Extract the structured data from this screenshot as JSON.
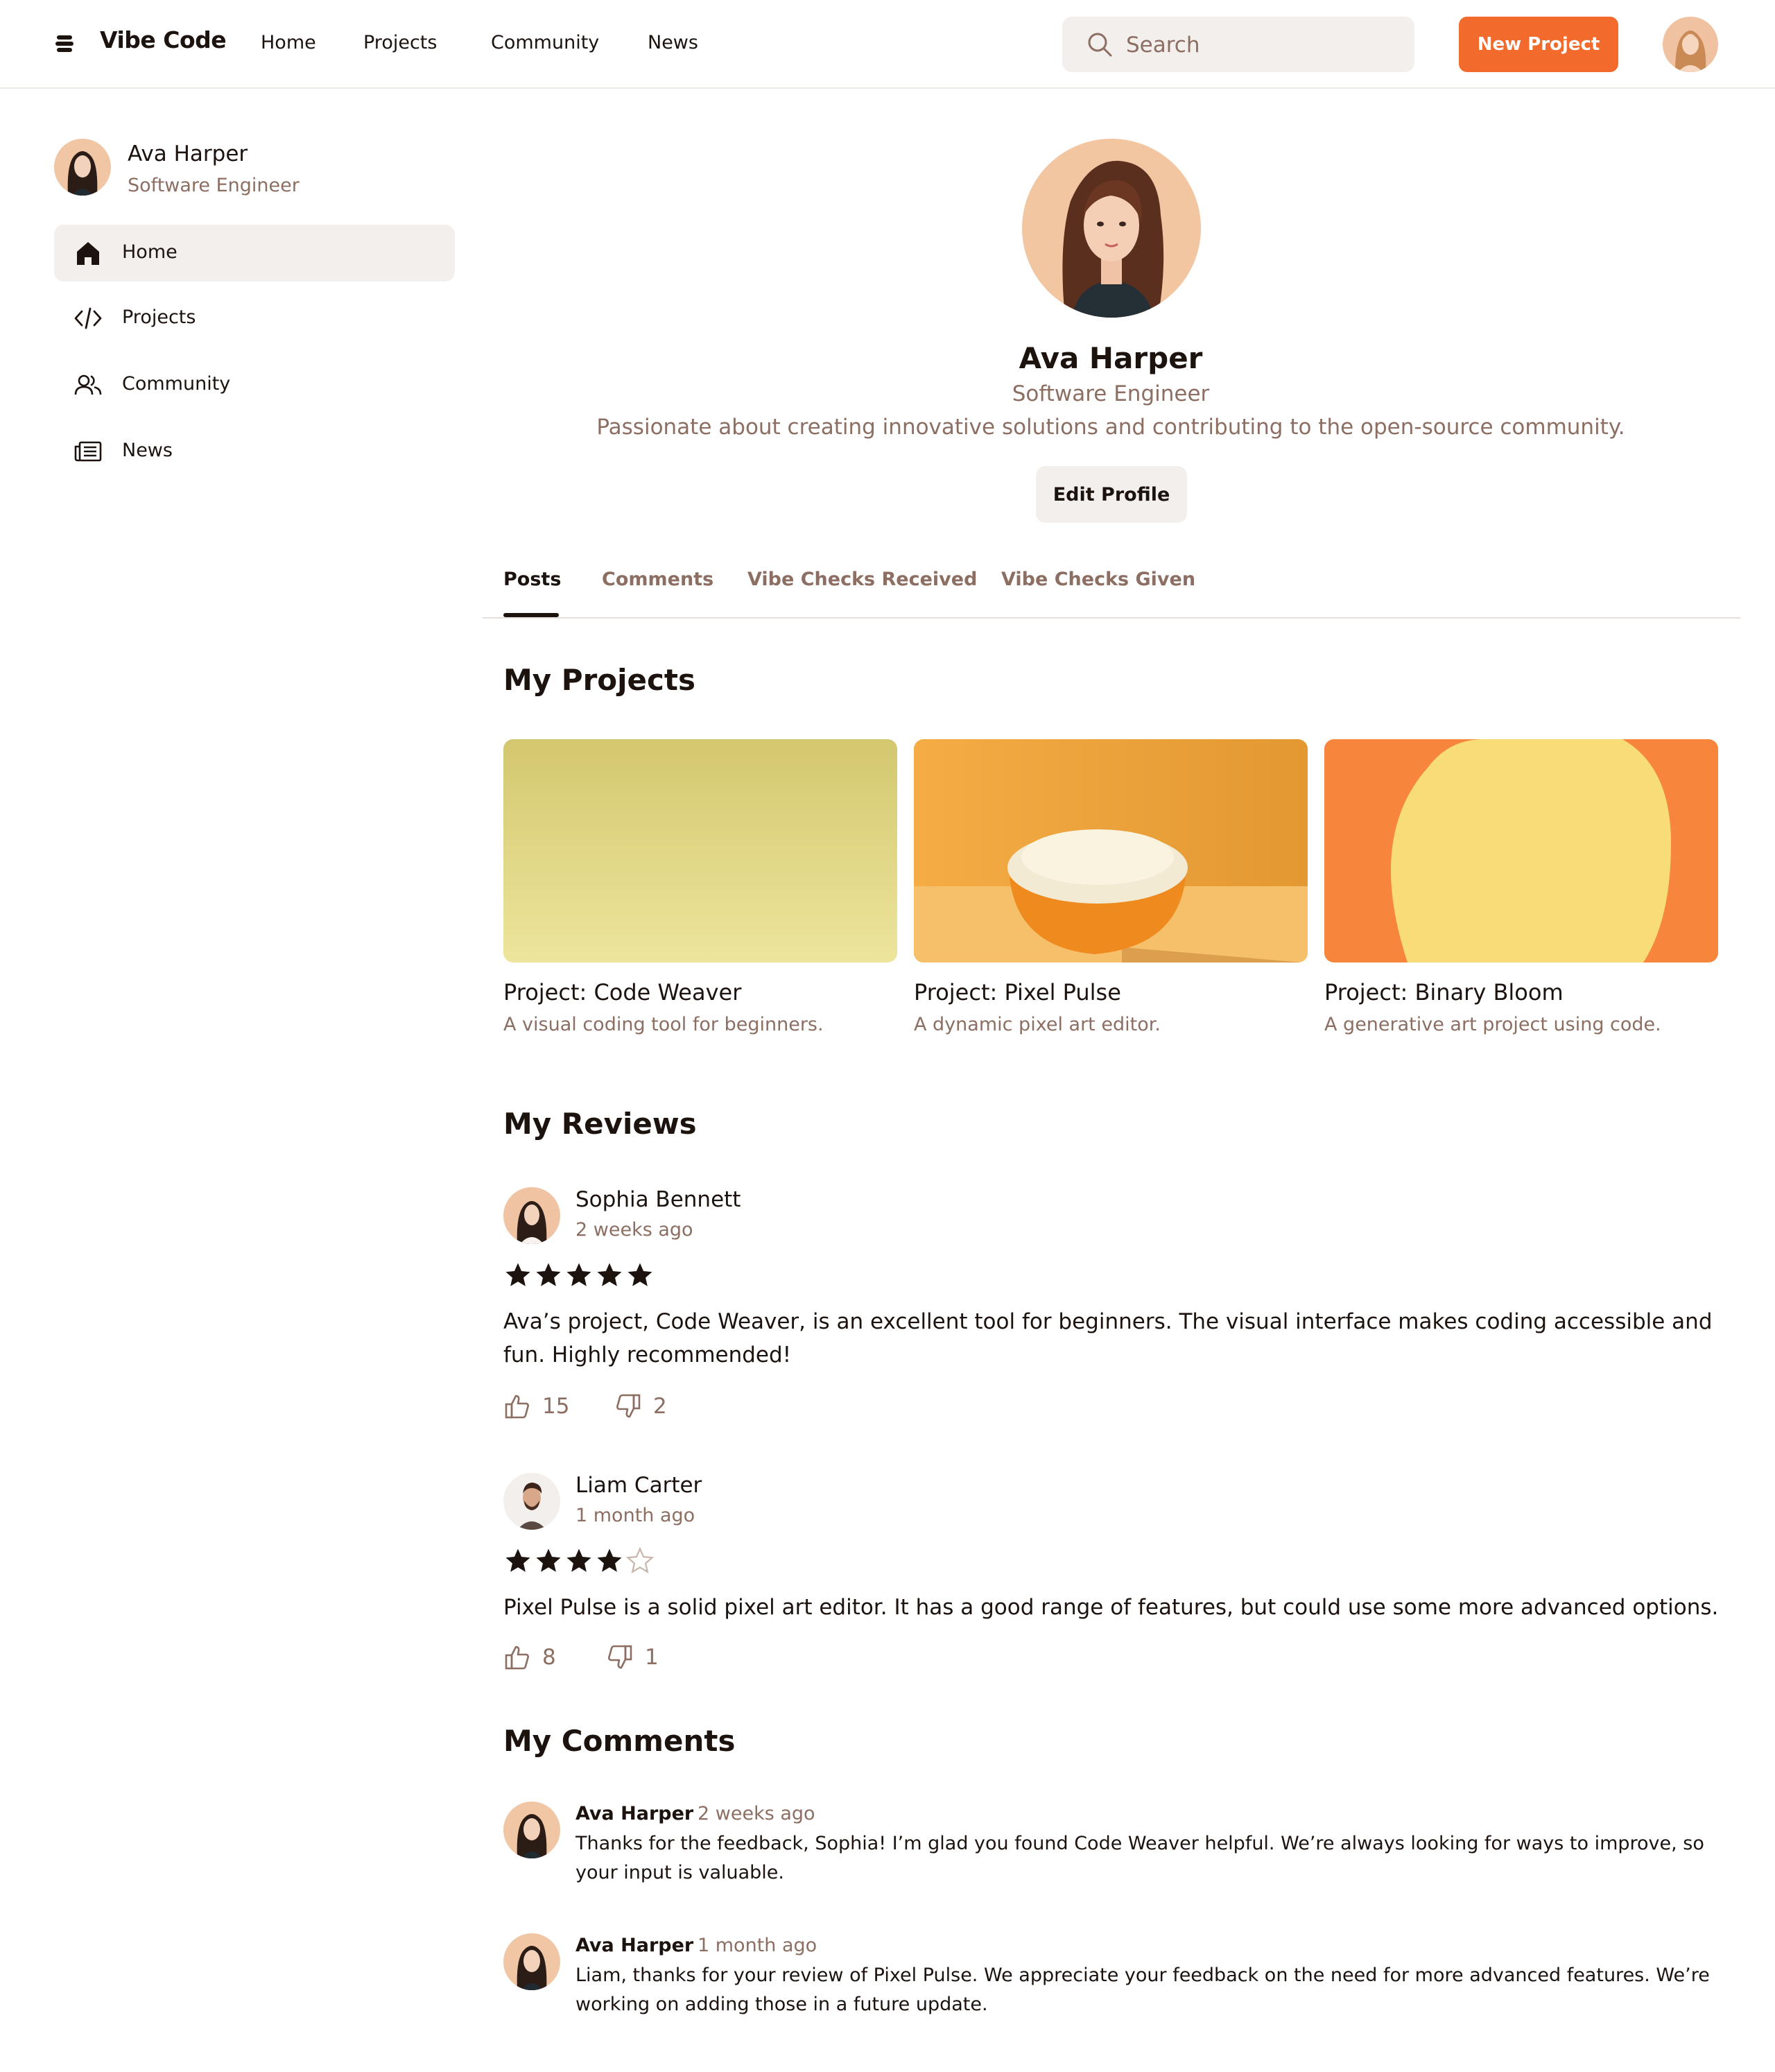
{
  "app": {
    "name": "Vibe Code",
    "icon": "stack-logo-icon"
  },
  "topnav": {
    "links": [
      "Home",
      "Projects",
      "Community",
      "News"
    ],
    "search_placeholder": "Search",
    "new_project_label": "New Project"
  },
  "sidebar": {
    "user": {
      "name": "Ava Harper",
      "role": "Software Engineer"
    },
    "items": [
      {
        "label": "Home",
        "icon": "home-icon",
        "active": true
      },
      {
        "label": "Projects",
        "icon": "code-icon",
        "active": false
      },
      {
        "label": "Community",
        "icon": "users-icon",
        "active": false
      },
      {
        "label": "News",
        "icon": "newspaper-icon",
        "active": false
      }
    ]
  },
  "profile": {
    "name": "Ava Harper",
    "role": "Software Engineer",
    "bio": "Passionate about creating innovative solutions and contributing to the open-source community.",
    "edit_label": "Edit Profile"
  },
  "tabs": [
    {
      "label": "Posts",
      "active": true
    },
    {
      "label": "Comments",
      "active": false
    },
    {
      "label": "Vibe Checks Received",
      "active": false
    },
    {
      "label": "Vibe Checks Given",
      "active": false
    }
  ],
  "projects": {
    "title": "My Projects",
    "items": [
      {
        "title": "Project: Code Weaver",
        "description": "A visual coding tool for beginners."
      },
      {
        "title": "Project: Pixel Pulse",
        "description": "A dynamic pixel art editor."
      },
      {
        "title": "Project: Binary Bloom",
        "description": "A generative art project using code."
      }
    ]
  },
  "reviews": {
    "title": "My Reviews",
    "items": [
      {
        "author": "Sophia Bennett",
        "time": "2 weeks ago",
        "rating": 5,
        "text": "Ava’s project, Code Weaver, is an excellent tool for beginners. The visual interface makes coding accessible and fun. Highly recommended!",
        "likes": "15",
        "dislikes": "2"
      },
      {
        "author": "Liam Carter",
        "time": "1 month ago",
        "rating": 4,
        "text": "Pixel Pulse is a solid pixel art editor. It has a good range of features, but could use some more advanced options.",
        "likes": "8",
        "dislikes": "1"
      }
    ]
  },
  "comments": {
    "title": "My Comments",
    "items": [
      {
        "author": "Ava Harper",
        "time": "2 weeks ago",
        "text": "Thanks for the feedback, Sophia! I’m glad you found Code Weaver helpful. We’re always looking for ways to improve, so your input is valuable."
      },
      {
        "author": "Ava Harper",
        "time": "1 month ago",
        "text": "Liam, thanks for your review of Pixel Pulse. We appreciate your feedback on the need for more advanced features. We’re working on adding those in a future update."
      }
    ]
  },
  "colors": {
    "accent": "#f26b2c",
    "muted_text": "#8c6e62",
    "surface": "#f3efed",
    "text": "#1c130f"
  }
}
